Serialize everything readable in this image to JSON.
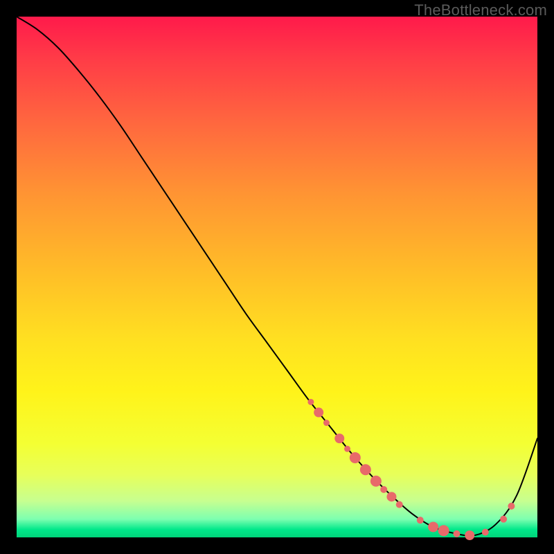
{
  "watermark": "TheBottleneck.com",
  "chart_data": {
    "type": "line",
    "title": "",
    "xlabel": "",
    "ylabel": "",
    "xlim": [
      0,
      100
    ],
    "ylim": [
      0,
      100
    ],
    "series": [
      {
        "name": "curve",
        "x": [
          0,
          4,
          8,
          12,
          16,
          20,
          24,
          28,
          32,
          36,
          40,
          44,
          48,
          52,
          56,
          60,
          64,
          68,
          72,
          76,
          80,
          84,
          88,
          92,
          96,
          100
        ],
        "y": [
          100,
          97.5,
          94,
          89.5,
          84.5,
          79,
          73,
          67,
          61,
          55,
          49,
          43,
          37.5,
          32,
          26.5,
          21.5,
          16.5,
          12,
          8,
          4.5,
          2,
          0.8,
          0.4,
          2.5,
          8,
          19
        ],
        "color": "#000000",
        "stroke_width": 2
      }
    ],
    "markers": [
      {
        "x": 56.5,
        "y": 26.0,
        "r": 4.5
      },
      {
        "x": 58.0,
        "y": 24.0,
        "r": 7.0
      },
      {
        "x": 59.5,
        "y": 22.0,
        "r": 4.5
      },
      {
        "x": 62.0,
        "y": 19.0,
        "r": 7.0
      },
      {
        "x": 63.5,
        "y": 17.0,
        "r": 4.5
      },
      {
        "x": 65.0,
        "y": 15.3,
        "r": 8.0
      },
      {
        "x": 67.0,
        "y": 13.0,
        "r": 8.0
      },
      {
        "x": 69.0,
        "y": 10.8,
        "r": 8.0
      },
      {
        "x": 70.5,
        "y": 9.2,
        "r": 5.0
      },
      {
        "x": 72.0,
        "y": 7.8,
        "r": 7.0
      },
      {
        "x": 73.5,
        "y": 6.3,
        "r": 5.0
      },
      {
        "x": 77.5,
        "y": 3.3,
        "r": 5.0
      },
      {
        "x": 80.0,
        "y": 2.0,
        "r": 7.5
      },
      {
        "x": 82.0,
        "y": 1.3,
        "r": 8.0
      },
      {
        "x": 84.5,
        "y": 0.7,
        "r": 5.0
      },
      {
        "x": 87.0,
        "y": 0.4,
        "r": 7.0
      },
      {
        "x": 90.0,
        "y": 1.0,
        "r": 5.0
      },
      {
        "x": 93.5,
        "y": 3.5,
        "r": 5.0
      },
      {
        "x": 95.0,
        "y": 6.0,
        "r": 5.0
      }
    ],
    "marker_color": "#e86a6a"
  }
}
